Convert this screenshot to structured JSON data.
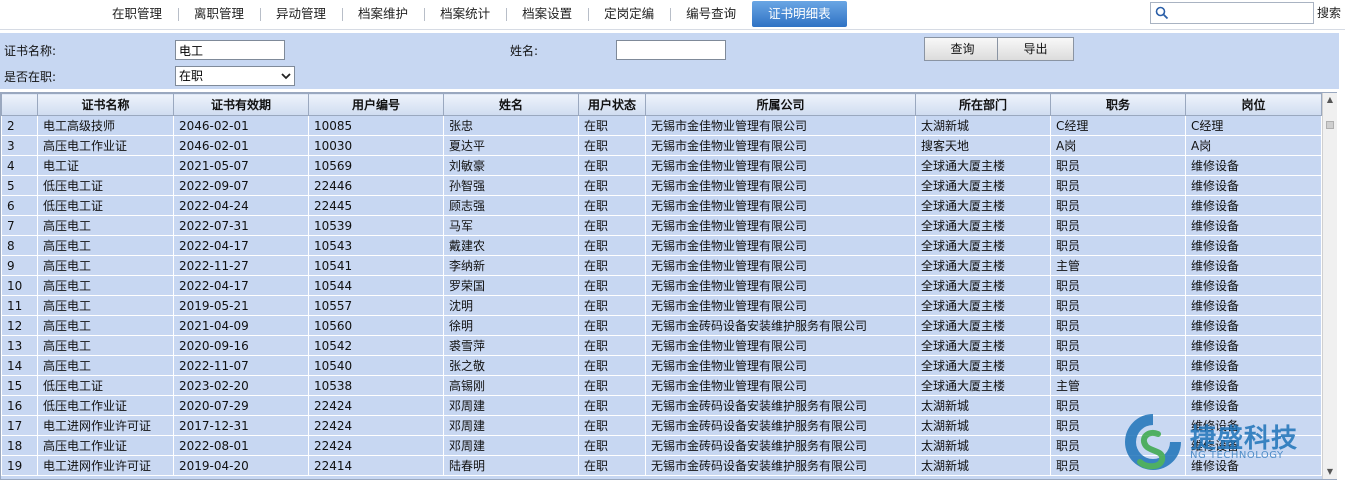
{
  "nav": {
    "items": [
      {
        "label": "在职管理",
        "active": false
      },
      {
        "label": "离职管理",
        "active": false
      },
      {
        "label": "异动管理",
        "active": false
      },
      {
        "label": "档案维护",
        "active": false
      },
      {
        "label": "档案统计",
        "active": false
      },
      {
        "label": "档案设置",
        "active": false
      },
      {
        "label": "定岗定编",
        "active": false
      },
      {
        "label": "编号查询",
        "active": false
      },
      {
        "label": "证书明细表",
        "active": true
      }
    ],
    "search_value": "",
    "search_label": "搜索"
  },
  "filter": {
    "cert_name_label": "证书名称:",
    "cert_name_value": "电工",
    "name_label": "姓名:",
    "name_value": "",
    "employed_label": "是否在职:",
    "employed_selected": "在职",
    "query_label": "查询",
    "export_label": "导出"
  },
  "table": {
    "columns": [
      "",
      "证书名称",
      "证书有效期",
      "用户编号",
      "姓名",
      "用户状态",
      "所属公司",
      "所在部门",
      "职务",
      "岗位"
    ],
    "rows": [
      [
        "2",
        "电工高级技师",
        "2046-02-01",
        "10085",
        "张忠",
        "在职",
        "无锡市金佳物业管理有限公司",
        "太湖新城",
        "C经理",
        "C经理"
      ],
      [
        "3",
        "高压电工作业证",
        "2046-02-01",
        "10030",
        "夏达平",
        "在职",
        "无锡市金佳物业管理有限公司",
        "搜客天地",
        "A岗",
        "A岗"
      ],
      [
        "4",
        "电工证",
        "2021-05-07",
        "10569",
        "刘敏豪",
        "在职",
        "无锡市金佳物业管理有限公司",
        "全球通大厦主楼",
        "职员",
        "维修设备"
      ],
      [
        "5",
        "低压电工证",
        "2022-09-07",
        "22446",
        "孙智强",
        "在职",
        "无锡市金佳物业管理有限公司",
        "全球通大厦主楼",
        "职员",
        "维修设备"
      ],
      [
        "6",
        "低压电工证",
        "2022-04-24",
        "22445",
        "顾志强",
        "在职",
        "无锡市金佳物业管理有限公司",
        "全球通大厦主楼",
        "职员",
        "维修设备"
      ],
      [
        "7",
        "高压电工",
        "2022-07-31",
        "10539",
        "马军",
        "在职",
        "无锡市金佳物业管理有限公司",
        "全球通大厦主楼",
        "职员",
        "维修设备"
      ],
      [
        "8",
        "高压电工",
        "2022-04-17",
        "10543",
        "戴建农",
        "在职",
        "无锡市金佳物业管理有限公司",
        "全球通大厦主楼",
        "职员",
        "维修设备"
      ],
      [
        "9",
        "高压电工",
        "2022-11-27",
        "10541",
        "李纳新",
        "在职",
        "无锡市金佳物业管理有限公司",
        "全球通大厦主楼",
        "主管",
        "维修设备"
      ],
      [
        "10",
        "高压电工",
        "2022-04-17",
        "10544",
        "罗荣国",
        "在职",
        "无锡市金佳物业管理有限公司",
        "全球通大厦主楼",
        "职员",
        "维修设备"
      ],
      [
        "11",
        "高压电工",
        "2019-05-21",
        "10557",
        "沈明",
        "在职",
        "无锡市金佳物业管理有限公司",
        "全球通大厦主楼",
        "职员",
        "维修设备"
      ],
      [
        "12",
        "高压电工",
        "2021-04-09",
        "10560",
        "徐明",
        "在职",
        "无锡市金砖码设备安装维护服务有限公司",
        "全球通大厦主楼",
        "职员",
        "维修设备"
      ],
      [
        "13",
        "高压电工",
        "2020-09-16",
        "10542",
        "裘雪萍",
        "在职",
        "无锡市金佳物业管理有限公司",
        "全球通大厦主楼",
        "职员",
        "维修设备"
      ],
      [
        "14",
        "高压电工",
        "2022-11-07",
        "10540",
        "张之敬",
        "在职",
        "无锡市金佳物业管理有限公司",
        "全球通大厦主楼",
        "职员",
        "维修设备"
      ],
      [
        "15",
        "低压电工证",
        "2023-02-20",
        "10538",
        "高锡刚",
        "在职",
        "无锡市金佳物业管理有限公司",
        "全球通大厦主楼",
        "主管",
        "维修设备"
      ],
      [
        "16",
        "低压电工作业证",
        "2020-07-29",
        "22424",
        "邓周建",
        "在职",
        "无锡市金砖码设备安装维护服务有限公司",
        "太湖新城",
        "职员",
        "维修设备"
      ],
      [
        "17",
        "电工进网作业许可证",
        "2017-12-31",
        "22424",
        "邓周建",
        "在职",
        "无锡市金砖码设备安装维护服务有限公司",
        "太湖新城",
        "职员",
        "维修设备"
      ],
      [
        "18",
        "高压电工作业证",
        "2022-08-01",
        "22424",
        "邓周建",
        "在职",
        "无锡市金砖码设备安装维护服务有限公司",
        "太湖新城",
        "职员",
        "维修设备"
      ],
      [
        "19",
        "电工进网作业许可证",
        "2019-04-20",
        "22414",
        "陆春明",
        "在职",
        "无锡市金砖码设备安装维护服务有限公司",
        "太湖新城",
        "职员",
        "维修设备"
      ]
    ]
  },
  "watermark": {
    "text": "捷盛科技",
    "subtext": "NG TECHNOLOGY"
  },
  "colors": {
    "panel_bg": "#c7d7f2",
    "active_tab": "#2f72c4",
    "logo_blue": "#1f74b9",
    "logo_green": "#3aa84a"
  }
}
